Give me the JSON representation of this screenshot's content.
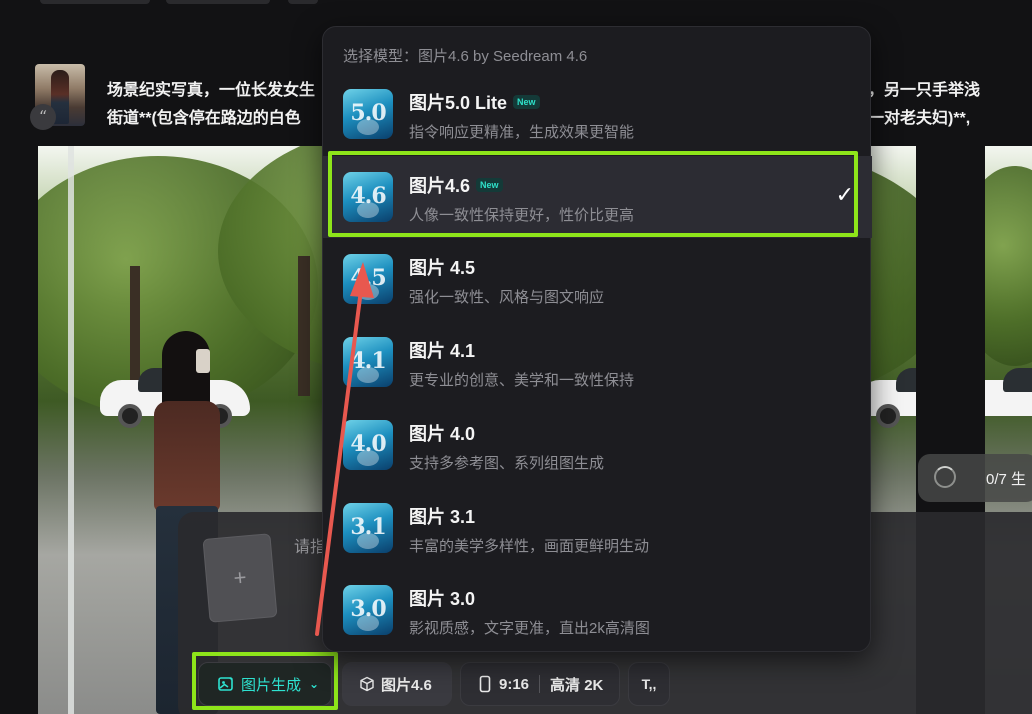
{
  "prompt": {
    "line1": "场景纪实写真，一位长发女生",
    "line1_end": "的服装，另一只手举浅",
    "line2": "街道**(包含停在路边的白色",
    "line2_end": "走过的一对老夫妇)**,"
  },
  "progress": {
    "label": "0/7 生"
  },
  "input": {
    "placeholder": "请指",
    "upload_icon": "plus-icon"
  },
  "toolbar": {
    "mode_label": "图片生成",
    "model_label": "图片4.6",
    "ratio_label": "9:16",
    "quality_label": "高清 2K",
    "text_icon_label": "T,,"
  },
  "dropdown": {
    "header": "选择模型：图片4.6 by Seedream 4.6",
    "selected_index": 1,
    "items": [
      {
        "name": "图片5.0 Lite",
        "badge": "New",
        "desc": "指令响应更精准，生成效果更智能",
        "thumb": "5.0"
      },
      {
        "name": "图片4.6",
        "badge": "New",
        "desc": "人像一致性保持更好，性价比更高",
        "thumb": "4.6"
      },
      {
        "name": "图片 4.5",
        "badge": "",
        "desc": "强化一致性、风格与图文响应",
        "thumb": "4.5"
      },
      {
        "name": "图片 4.1",
        "badge": "",
        "desc": "更专业的创意、美学和一致性保持",
        "thumb": "4.1"
      },
      {
        "name": "图片 4.0",
        "badge": "",
        "desc": "支持多参考图、系列组图生成",
        "thumb": "4.0"
      },
      {
        "name": "图片 3.1",
        "badge": "",
        "desc": "丰富的美学多样性，画面更鲜明生动",
        "thumb": "3.1"
      },
      {
        "name": "图片 3.0",
        "badge": "",
        "desc": "影视质感，文字更准，直出2k高清图",
        "thumb": "3.0"
      }
    ]
  },
  "colors": {
    "accent": "#2ee2d0",
    "highlight": "#8ee51a",
    "arrow": "#e8584f"
  }
}
